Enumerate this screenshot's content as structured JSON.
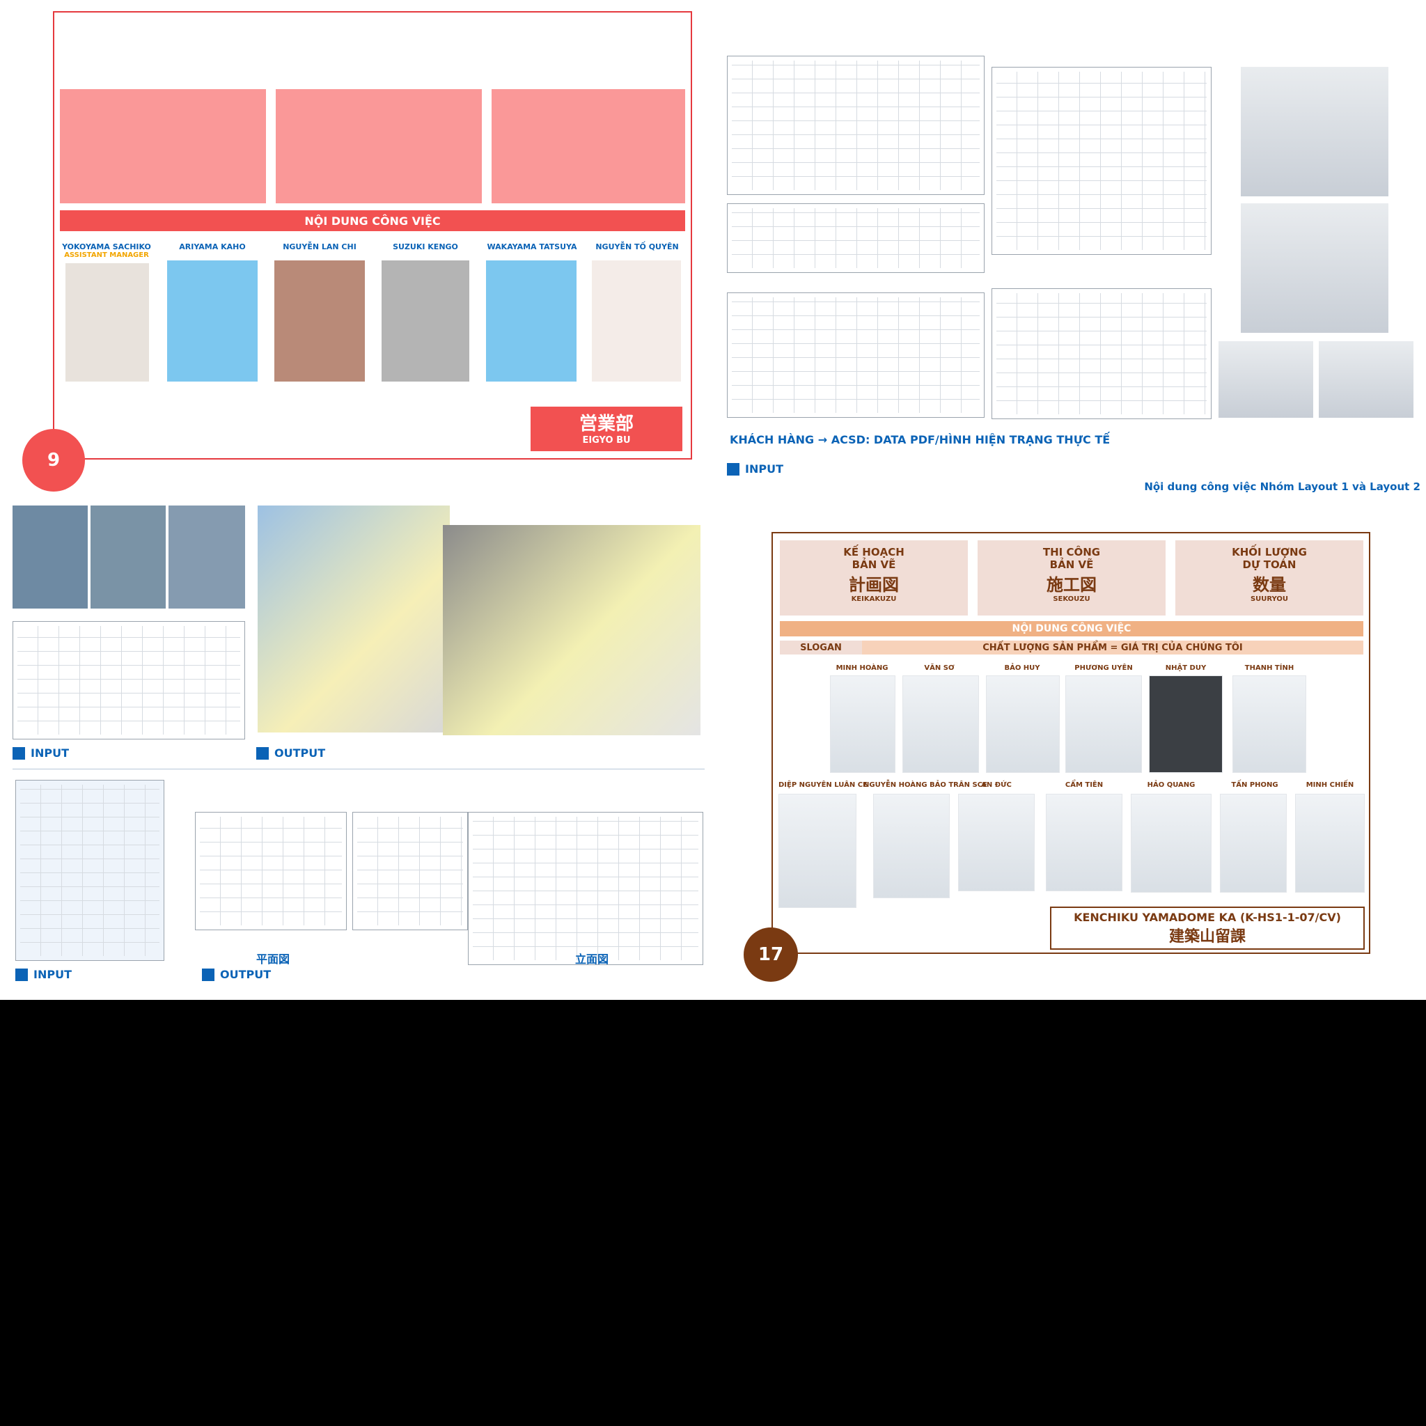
{
  "panel1": {
    "number": "9",
    "banner": "NỘI DUNG CÔNG VIỆC",
    "team_cn": "営業部",
    "team_en": "EIGYO BU",
    "members": [
      {
        "name": "YOKOYAMA SACHIKO",
        "role": "ASSISTANT MANAGER"
      },
      {
        "name": "ARIYAMA KAHO",
        "role": ""
      },
      {
        "name": "NGUYỄN LAN CHI",
        "role": ""
      },
      {
        "name": "SUZUKI KENGO",
        "role": ""
      },
      {
        "name": "WAKAYAMA TATSUYA",
        "role": ""
      },
      {
        "name": "NGUYỄN TỐ QUYÊN",
        "role": ""
      }
    ]
  },
  "panel2": {
    "title": "Nội dung công việc Nhóm Layout 1 và Layout 2",
    "caption": "KHÁCH HÀNG → ACSD: DATA PDF/HÌNH HIỆN TRẠNG THỰC TẾ",
    "input_label": "INPUT"
  },
  "panel3": {
    "input_label_top": "INPUT",
    "output_label_top": "OUTPUT",
    "input_label_bottom": "INPUT",
    "output_label_bottom": "OUTPUT",
    "plan_label": "平面図",
    "elevation_label": "立面図"
  },
  "panel4": {
    "number": "17",
    "categories": [
      {
        "vn1": "KẾ HOẠCH",
        "vn2": "BẢN VẼ",
        "jp": "計画図",
        "romaji": "KEIKAKUZU"
      },
      {
        "vn1": "THI CÔNG",
        "vn2": "BẢN VẼ",
        "jp": "施工図",
        "romaji": "SEKOUZU"
      },
      {
        "vn1": "KHỐI LƯỢNG",
        "vn2": "DỰ TOÁN",
        "jp": "数量",
        "romaji": "SUURYOU"
      }
    ],
    "banner": "NỘI DUNG CÔNG VIỆC",
    "slogan_label": "SLOGAN",
    "slogan": "CHẤT LƯỢNG SẢN PHẨM = GIÁ TRỊ CỦA CHÚNG TÔI",
    "row1": [
      "MINH HOÀNG",
      "VĂN SƠ",
      "BẢO HUY",
      "PHƯƠNG UYÊN",
      "NHẬT DUY",
      "THANH TÍNH"
    ],
    "row2": [
      "DIỆP NGUYÊN LUÂN CE",
      "NGUYỄN HOÀNG BẢO TRÂN SCE",
      "AN ĐỨC",
      "CẨM TIÊN",
      "HẢO QUANG",
      "TẤN PHONG",
      "MINH CHIẾN"
    ],
    "team_en": "KENCHIKU YAMADOME KA (K-HS1-1-07/CV)",
    "team_jp": "建築山留課"
  },
  "colors": {
    "red": "#f25151",
    "pink": "#fa9898",
    "blue": "#0b63b6",
    "brown": "#7a3a12",
    "orange": "#f0b184"
  }
}
